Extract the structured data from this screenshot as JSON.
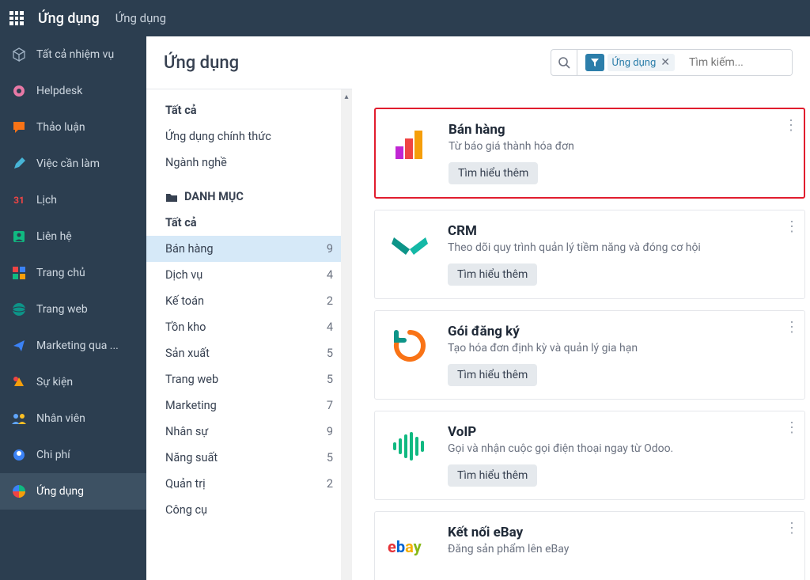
{
  "topbar": {
    "brand": "Ứng dụng",
    "breadcrumb": "Ứng dụng"
  },
  "leftnav": [
    {
      "id": "all-tasks",
      "label": "Tất cả nhiệm vụ"
    },
    {
      "id": "helpdesk",
      "label": "Helpdesk"
    },
    {
      "id": "discuss",
      "label": "Thảo luận"
    },
    {
      "id": "todo",
      "label": "Việc cần làm"
    },
    {
      "id": "calendar",
      "label": "Lịch"
    },
    {
      "id": "contacts",
      "label": "Liên hệ"
    },
    {
      "id": "home",
      "label": "Trang chủ"
    },
    {
      "id": "website",
      "label": "Trang web"
    },
    {
      "id": "marketing",
      "label": "Marketing qua ..."
    },
    {
      "id": "events",
      "label": "Sự kiện"
    },
    {
      "id": "employees",
      "label": "Nhân viên"
    },
    {
      "id": "expenses",
      "label": "Chi phí"
    },
    {
      "id": "apps",
      "label": "Ứng dụng",
      "active": true
    }
  ],
  "page": {
    "title": "Ứng dụng"
  },
  "search": {
    "chip_label": "Ứng dụng",
    "placeholder": "Tìm kiếm..."
  },
  "filters": {
    "top": [
      {
        "label": "Tất cả",
        "bold": true
      },
      {
        "label": "Ứng dụng chính thức"
      },
      {
        "label": "Ngành nghề"
      }
    ],
    "header": "DANH MỤC",
    "cats": [
      {
        "label": "Tất cả",
        "count": "",
        "bold": true
      },
      {
        "label": "Bán hàng",
        "count": "9",
        "selected": true
      },
      {
        "label": "Dịch vụ",
        "count": "4"
      },
      {
        "label": "Kế toán",
        "count": "2"
      },
      {
        "label": "Tồn kho",
        "count": "4"
      },
      {
        "label": "Sản xuất",
        "count": "5"
      },
      {
        "label": "Trang web",
        "count": "5"
      },
      {
        "label": "Marketing",
        "count": "7"
      },
      {
        "label": "Nhân sự",
        "count": "9"
      },
      {
        "label": "Năng suất",
        "count": "5"
      },
      {
        "label": "Quản trị",
        "count": "2"
      },
      {
        "label": "Công cụ",
        "count": ""
      }
    ]
  },
  "apps": [
    {
      "title": "Bán hàng",
      "desc": "Từ báo giá thành hóa đơn",
      "action": "Tìm hiểu thêm",
      "highlight": true
    },
    {
      "title": "CRM",
      "desc": "Theo dõi quy trình quản lý tiềm năng và đóng cơ hội",
      "action": "Tìm hiểu thêm"
    },
    {
      "title": "Gói đăng ký",
      "desc": "Tạo hóa đơn định kỳ và quản lý gia hạn",
      "action": "Tìm hiểu thêm"
    },
    {
      "title": "VoIP",
      "desc": "Gọi và nhận cuộc gọi điện thoại ngay từ Odoo.",
      "action": "Tìm hiểu thêm"
    },
    {
      "title": "Kết nối eBay",
      "desc": "Đăng sản phẩm lên eBay",
      "action": "Tìm hiểu thêm"
    }
  ]
}
